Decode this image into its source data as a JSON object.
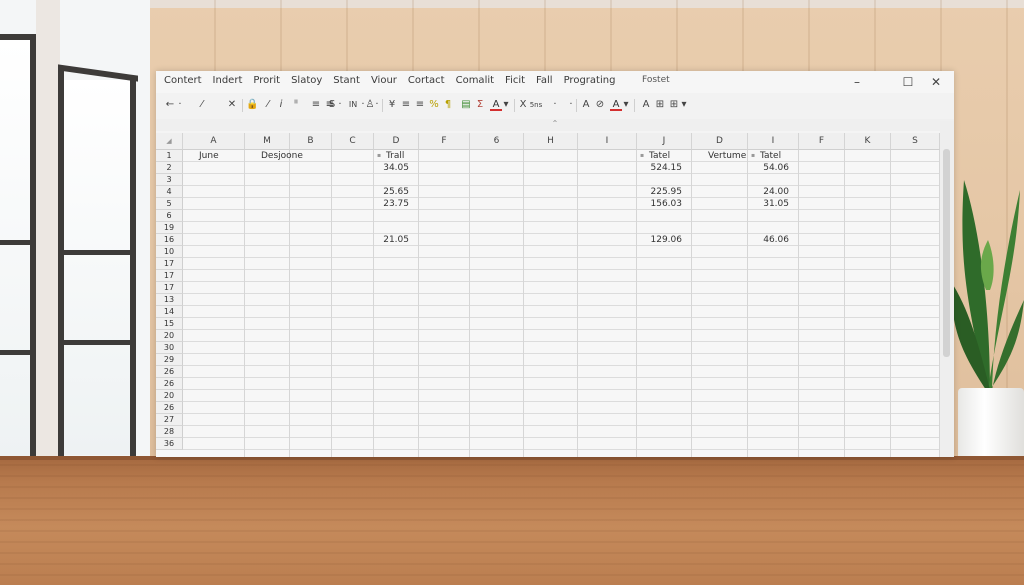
{
  "menu": [
    "Contert",
    "Indert",
    "Prorit",
    "Slatoy",
    "Stant",
    "Viour",
    "Cortact",
    "Comalit",
    "Ficit",
    "Fall",
    "Prograting"
  ],
  "app_title": "Fostet",
  "window_controls": {
    "minimize": "–",
    "maximize": "☐",
    "close": "✕"
  },
  "toolbar": {
    "back": "←",
    "back_caret": "·",
    "pen": "⁄",
    "clear": "✕",
    "lock": "🔒",
    "slash": "⁄",
    "italic": "i",
    "font_size": "ᴵᴵ",
    "align_eq": "≡",
    "list": "≡",
    "strike": "S",
    "strike_caret": "·",
    "indent_label": "IN",
    "indent_caret": "·",
    "paint": "♙",
    "paint_caret": "·",
    "eq_sign": "¥",
    "align_left": "≡",
    "align_center": "≡",
    "format_a": "%",
    "format_b": "¶",
    "chart": "▤",
    "sum": "Σ",
    "color_a": "A",
    "color_a_caret": "▾",
    "x_label": "X",
    "mode": "5ns",
    "mode_caret": "·",
    "size_caret": "·",
    "shape_a": "A",
    "shape_b": "⊘",
    "text_color": "A",
    "text_color_caret": "▾",
    "warn": "A",
    "delete": "⊞",
    "grid_menu": "⊞",
    "grid_caret": "▾"
  },
  "strip_caret": "⌃",
  "sheet": {
    "corner": "◢",
    "columns": [
      "A",
      "M",
      "B",
      "C",
      "D",
      "F",
      "6",
      "H",
      "I",
      "J",
      "D",
      "I",
      "F",
      "K",
      "S"
    ],
    "rows": [
      "1",
      "2",
      "3",
      "4",
      "5",
      "6",
      "19",
      "16",
      "10",
      "17",
      "17",
      "17",
      "13",
      "14",
      "15",
      "20",
      "30",
      "29",
      "26",
      "26",
      "20",
      "26",
      "27",
      "28",
      "36"
    ],
    "cells": [
      {
        "r": 0,
        "c": 0,
        "text": "June",
        "align": "left"
      },
      {
        "r": 0,
        "c": 1,
        "text": "Desjoone",
        "align": "left"
      },
      {
        "r": 0,
        "c": 4,
        "text": "Trall",
        "align": "left",
        "mark": true
      },
      {
        "r": 0,
        "c": 9,
        "text": "Tatel",
        "align": "left",
        "mark": true
      },
      {
        "r": 0,
        "c": 10,
        "text": "Vertume",
        "align": "left"
      },
      {
        "r": 0,
        "c": 11,
        "text": "Tatel",
        "align": "left",
        "mark": true
      },
      {
        "r": 1,
        "c": 4,
        "text": "34.05",
        "align": "right"
      },
      {
        "r": 1,
        "c": 9,
        "text": "524.15",
        "align": "right"
      },
      {
        "r": 1,
        "c": 11,
        "text": "54.06",
        "align": "right"
      },
      {
        "r": 3,
        "c": 4,
        "text": "25.65",
        "align": "right"
      },
      {
        "r": 3,
        "c": 9,
        "text": "225.95",
        "align": "right"
      },
      {
        "r": 3,
        "c": 11,
        "text": "24.00",
        "align": "right"
      },
      {
        "r": 4,
        "c": 4,
        "text": "23.75",
        "align": "right"
      },
      {
        "r": 4,
        "c": 9,
        "text": "156.03",
        "align": "right"
      },
      {
        "r": 4,
        "c": 11,
        "text": "31.05",
        "align": "right"
      },
      {
        "r": 7,
        "c": 4,
        "text": "21.05",
        "align": "right"
      },
      {
        "r": 7,
        "c": 9,
        "text": "129.06",
        "align": "right"
      },
      {
        "r": 7,
        "c": 11,
        "text": "46.06",
        "align": "right"
      }
    ]
  }
}
